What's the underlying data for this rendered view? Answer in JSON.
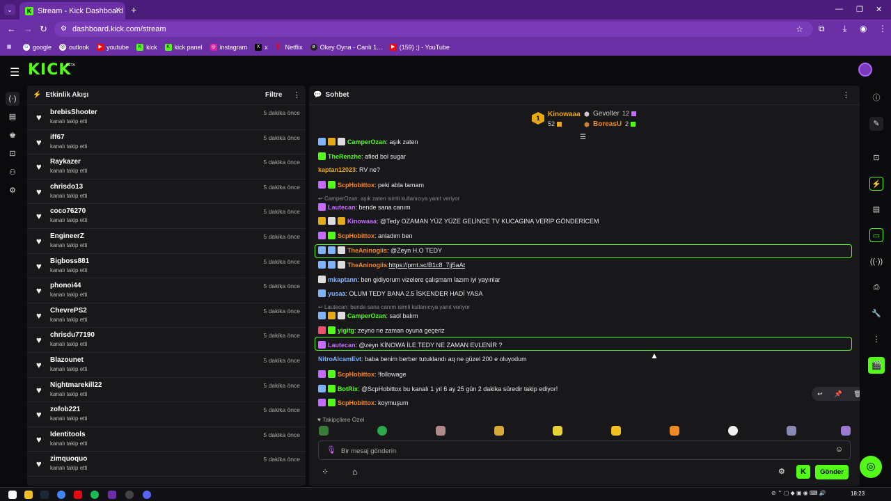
{
  "browser": {
    "tab_title": "Stream - Kick Dashboard",
    "url": "dashboard.kick.com/stream",
    "bookmarks": [
      "google",
      "outlook",
      "youtube",
      "kick",
      "kick panel",
      "instagram",
      "x",
      "Netflix",
      "Okey Oyna - Canlı 1...",
      "(159) ;) - YouTube"
    ]
  },
  "header": {
    "logo": "KICK",
    "beta": "BETA"
  },
  "activity": {
    "title": "Etkinlik Akışı",
    "filter": "Filtre",
    "items": [
      {
        "name": "brebisShooter",
        "action": "kanalı takip etti",
        "time": "5 dakika önce"
      },
      {
        "name": "iff67",
        "action": "kanalı takip etti",
        "time": "5 dakika önce"
      },
      {
        "name": "Raykazer",
        "action": "kanalı takip etti",
        "time": "5 dakika önce"
      },
      {
        "name": "chrisdo13",
        "action": "kanalı takip etti",
        "time": "5 dakika önce"
      },
      {
        "name": "coco76270",
        "action": "kanalı takip etti",
        "time": "5 dakika önce"
      },
      {
        "name": "EngineerZ",
        "action": "kanalı takip etti",
        "time": "5 dakika önce"
      },
      {
        "name": "Bigboss881",
        "action": "kanalı takip etti",
        "time": "5 dakika önce"
      },
      {
        "name": "phonoi44",
        "action": "kanalı takip etti",
        "time": "5 dakika önce"
      },
      {
        "name": "ChevrePS2",
        "action": "kanalı takip etti",
        "time": "5 dakika önce"
      },
      {
        "name": "chrisdu77190",
        "action": "kanalı takip etti",
        "time": "5 dakika önce"
      },
      {
        "name": "Blazounet",
        "action": "kanalı takip etti",
        "time": "5 dakika önce"
      },
      {
        "name": "Nightmarekill22",
        "action": "kanalı takip etti",
        "time": "5 dakika önce"
      },
      {
        "name": "zofob221",
        "action": "kanalı takip etti",
        "time": "5 dakika önce"
      },
      {
        "name": "Identitools",
        "action": "kanalı takip etti",
        "time": "5 dakika önce"
      },
      {
        "name": "zimquoquo",
        "action": "kanalı takip etti",
        "time": "5 dakika önce"
      }
    ]
  },
  "chat": {
    "title": "Sohbet",
    "leaderboard": [
      {
        "name": "Kinowaaa",
        "count": "52",
        "rank": "1"
      },
      {
        "name": "Gevolter",
        "count": "12"
      },
      {
        "name": "BoreasU",
        "count": "2"
      }
    ],
    "messages": [
      {
        "user": "CamperOzan",
        "text": ": aşık zaten",
        "color": "#53fc18"
      },
      {
        "user": "TheRenzhe",
        "text": ": afied bol sugar",
        "color": "#53fc18"
      },
      {
        "user": "kaptan12023",
        "text": ": RV ne?",
        "color": "#e6a817"
      },
      {
        "user": "ScpHobittox",
        "text": ": peki abla tamam",
        "color": "#f08a24"
      },
      {
        "reply": "CamperOzan: aşık zaten isimli kullanıcıya yanıt veriyor"
      },
      {
        "user": "Lautecan",
        "text": ": bende sana canım",
        "color": "#c66bff"
      },
      {
        "user": "Kinowaaa",
        "text": ": @Tedy OZAMAN YÜZ YÜZE GELİNCE TV KUCAGINA VERİP GÖNDERİCEM",
        "color": "#c66bff"
      },
      {
        "user": "ScpHobittox",
        "text": ": anladım ben",
        "color": "#f08a24"
      },
      {
        "user": "TheAninogiis",
        "text": ": @Zeyn H.O TEDY",
        "color": "#f08a24"
      },
      {
        "user": "TheAninogiis",
        "text": ": ",
        "link": "https://prnt.sc/B1c8_7jj5aAt",
        "color": "#f08a24"
      },
      {
        "user": "mkaptann",
        "text": ": ben gidiyorum vizelere çalışmam lazım iyi yayınlar",
        "color": "#7fb2ff"
      },
      {
        "user": "yusaa",
        "text": ": OLUM TEDY BANA 2.5 İSKENDER HADİ YASA",
        "color": "#7fb2ff"
      },
      {
        "reply": "Lautecan: bende sana canım isimli kullanıcıya yanıt veriyor"
      },
      {
        "user": "CamperOzan",
        "text": ": saol balım",
        "color": "#53fc18"
      },
      {
        "user": "yigitg",
        "text": ": zeyno ne zaman oyuna geçeriz",
        "color": "#53fc18"
      },
      {
        "user": "Lautecan",
        "text": ": @zeyn KİNOWA İLE TEDY NE ZAMAN EVLENİR ?",
        "color": "#c66bff"
      },
      {
        "user": "NitroAlcamEvt",
        "text": ": baba benim berber tutuklandı aq ne güzel 200 e oluyodum",
        "color": "#7fb2ff"
      },
      {
        "user": "ScpHobittox",
        "text": ": !followage",
        "color": "#f08a24"
      },
      {
        "user": "BotRix",
        "text": ": @ScpHobittox bu kanalı 1 yıl 6 ay 25 gün 2 dakika süredir takip ediyor!",
        "color": "#53fc18"
      },
      {
        "user": "ScpHobittox",
        "text": ": koymuşum",
        "color": "#f08a24"
      }
    ],
    "followers_label": "Takipçilere Özel",
    "input_placeholder": "Bir mesaj gönderin",
    "send": "Gönder"
  },
  "taskbar": {
    "time": "18:23"
  }
}
